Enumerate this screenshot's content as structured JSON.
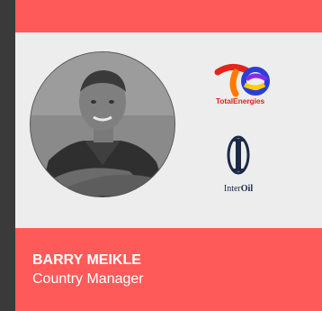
{
  "profile": {
    "name": "BARRY MEIKLE",
    "role": "Country Manager"
  },
  "logos": {
    "total": "TotalEnergies",
    "interoil_prefix": "Inter",
    "interoil_bold": "Oil"
  },
  "colors": {
    "accent": "#ff5a5a",
    "card_bg": "#ededed",
    "page_bg": "#3a3a3a"
  }
}
